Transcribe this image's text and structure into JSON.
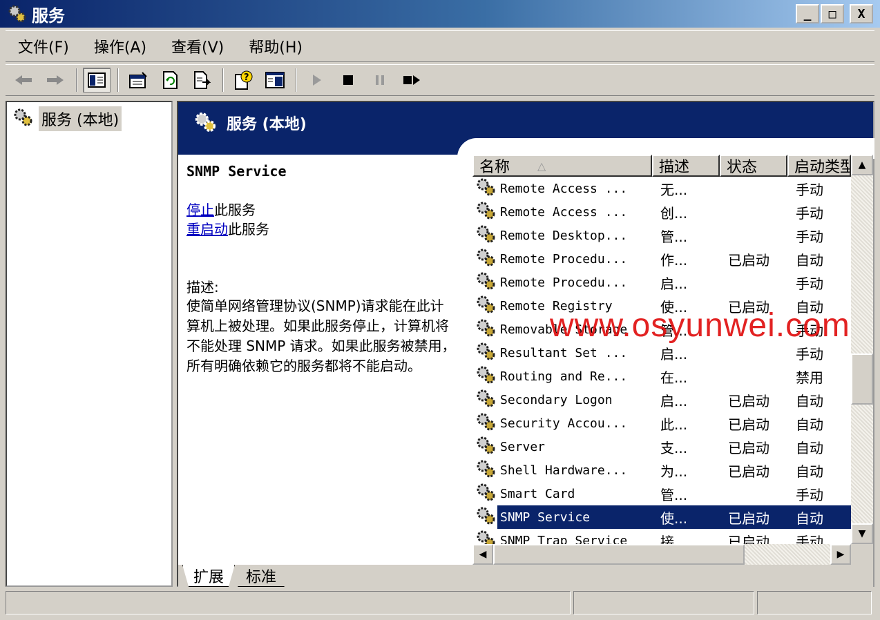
{
  "window": {
    "title": "服务",
    "minimize": "_",
    "maximize": "□",
    "close": "X"
  },
  "menu": [
    "文件(F)",
    "操作(A)",
    "查看(V)",
    "帮助(H)"
  ],
  "toolbar_icons": [
    "back-arrow-icon",
    "forward-arrow-icon",
    "show-hide-tree-icon",
    "properties-icon",
    "refresh-icon",
    "export-list-icon",
    "help-icon",
    "console-tree-icon",
    "start-service-icon",
    "stop-service-icon",
    "pause-service-icon",
    "restart-service-icon"
  ],
  "tree": {
    "label": "服务 (本地)"
  },
  "header": {
    "title": "服务 (本地)"
  },
  "detail": {
    "service_name": "SNMP Service",
    "stop_link": "停止",
    "stop_suffix": "此服务",
    "restart_link": "重启动",
    "restart_suffix": "此服务",
    "desc_label": "描述:",
    "desc_text": "使简单网络管理协议(SNMP)请求能在此计算机上被处理。如果此服务停止，计算机将不能处理 SNMP 请求。如果此服务被禁用，所有明确依赖它的服务都将不能启动。"
  },
  "list": {
    "columns": [
      "名称",
      "描述",
      "状态",
      "启动类型"
    ],
    "sort_indicator": "△",
    "rows": [
      {
        "name": "Remote Access ...",
        "desc": "无...",
        "status": "",
        "startup": "手动"
      },
      {
        "name": "Remote Access ...",
        "desc": "创...",
        "status": "",
        "startup": "手动"
      },
      {
        "name": "Remote Desktop...",
        "desc": "管...",
        "status": "",
        "startup": "手动"
      },
      {
        "name": "Remote Procedu...",
        "desc": "作...",
        "status": "已启动",
        "startup": "自动"
      },
      {
        "name": "Remote Procedu...",
        "desc": "启...",
        "status": "",
        "startup": "手动"
      },
      {
        "name": "Remote Registry",
        "desc": "使...",
        "status": "已启动",
        "startup": "自动"
      },
      {
        "name": "Removable Storage",
        "desc": "管...",
        "status": "",
        "startup": "手动"
      },
      {
        "name": "Resultant Set ...",
        "desc": "启...",
        "status": "",
        "startup": "手动"
      },
      {
        "name": "Routing and Re...",
        "desc": "在...",
        "status": "",
        "startup": "禁用"
      },
      {
        "name": "Secondary Logon",
        "desc": "启...",
        "status": "已启动",
        "startup": "自动"
      },
      {
        "name": "Security Accou...",
        "desc": "此...",
        "status": "已启动",
        "startup": "自动"
      },
      {
        "name": "Server",
        "desc": "支...",
        "status": "已启动",
        "startup": "自动"
      },
      {
        "name": "Shell Hardware...",
        "desc": "为...",
        "status": "已启动",
        "startup": "自动"
      },
      {
        "name": "Smart Card",
        "desc": "管...",
        "status": "",
        "startup": "手动"
      },
      {
        "name": "SNMP Service",
        "desc": "使...",
        "status": "已启动",
        "startup": "自动",
        "selected": true
      },
      {
        "name": "SNMP Trap Service",
        "desc": "接...",
        "status": "已启动",
        "startup": "手动"
      }
    ]
  },
  "tabs": [
    "扩展",
    "标准"
  ],
  "watermark": "www.osyunwei.com",
  "colors": {
    "title_bar": "#0a246a",
    "selection": "#0a246a",
    "link": "#0000c0",
    "watermark": "#e01010"
  }
}
